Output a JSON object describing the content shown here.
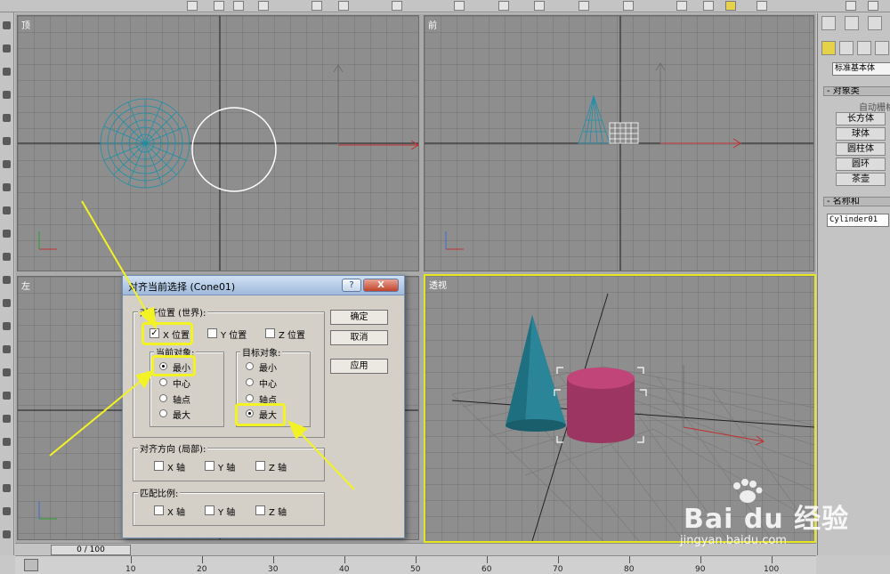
{
  "viewports": {
    "top": {
      "label": "顶"
    },
    "front": {
      "label": "前"
    },
    "left": {
      "label": "左"
    },
    "perspective": {
      "label": "透视"
    }
  },
  "dialog": {
    "title": "对齐当前选择 (Cone01)",
    "help_label": "?",
    "close_label": "X",
    "align_position_group": "对齐位置 (世界):",
    "x_position": "X 位置",
    "y_position": "Y 位置",
    "z_position": "Z 位置",
    "x_position_checked": true,
    "y_position_checked": false,
    "z_position_checked": false,
    "current_object_group": "当前对象:",
    "target_object_group": "目标对象:",
    "options": [
      "最小",
      "中心",
      "轴点",
      "最大"
    ],
    "current_selected": "最小",
    "target_selected": "最大",
    "ok_button": "确定",
    "cancel_button": "取消",
    "apply_button": "应用",
    "align_orientation_group": "对齐方向 (局部):",
    "match_scale_group": "匹配比例:",
    "x_axis": "X 轴",
    "y_axis": "Y 轴",
    "z_axis": "Z 轴"
  },
  "command_panel": {
    "dropdown": "标准基本体",
    "object_type_rollout": "- 对象类",
    "auto_grid": "自动栅格",
    "buttons": [
      "长方体",
      "球体",
      "圆柱体",
      "圆环",
      "茶壶"
    ],
    "name_color_rollout": "- 名称和",
    "object_name": "Cylinder01"
  },
  "timeline": {
    "frame_display": "0 / 100",
    "ticks": [
      "10",
      "20",
      "30",
      "40",
      "50",
      "60",
      "70",
      "80",
      "90",
      "100"
    ]
  },
  "watermark": {
    "brand": "Bai du 经验",
    "url": "jingyan.baidu.com"
  },
  "colors": {
    "highlight": "#f2f224",
    "cone": "#1e6f80",
    "cylinder": "#c2457a",
    "active_viewport_border": "#e6e61e"
  }
}
